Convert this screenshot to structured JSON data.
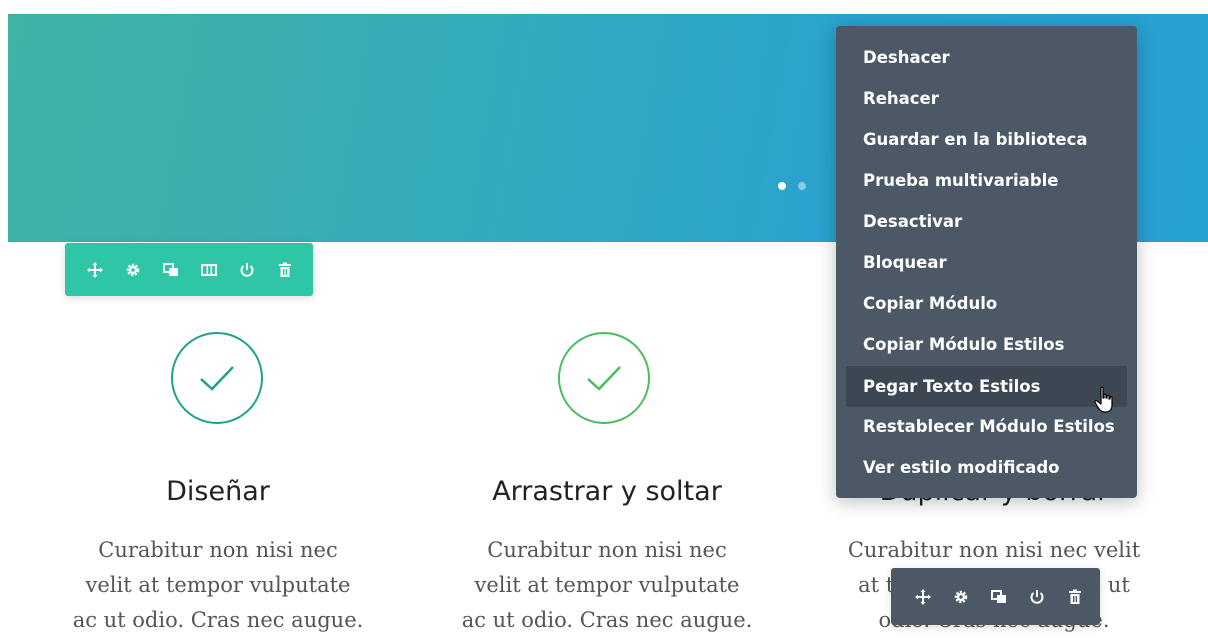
{
  "hero": {
    "slider_dots": [
      "active",
      "inactive"
    ]
  },
  "row_toolbar": {
    "icons": [
      "move-icon",
      "gear-icon",
      "clone-icon",
      "columns-icon",
      "power-icon",
      "trash-icon"
    ],
    "color": "#2ec6a6"
  },
  "columns": [
    {
      "heading": "Diseñar",
      "lines": [
        "Curabitur non nisi nec",
        "velit at tempor vulputate",
        "ac ut odio. Cras nec augue."
      ],
      "check_color": "#1fa18a"
    },
    {
      "heading": "Arrastrar y soltar",
      "lines": [
        "Curabitur non nisi nec",
        "velit at tempor vulputate",
        "ac ut odio. Cras nec augue."
      ],
      "check_color": "#4dbb5f"
    },
    {
      "heading": "Duplicar y borrar",
      "lines": [
        "Curabitur non nisi nec velit",
        "at tempor vulputate ac ut",
        "odio. Cras nec augue."
      ]
    }
  ],
  "context_menu": {
    "items": [
      "Deshacer",
      "Rehacer",
      "Guardar en la biblioteca",
      "Prueba multivariable",
      "Desactivar",
      "Bloquear",
      "Copiar Módulo",
      "Copiar Módulo Estilos",
      "Pegar Texto Estilos",
      "Restablecer Módulo Estilos",
      "Ver estilo modificado"
    ],
    "hovered": "Pegar Texto Estilos",
    "background": "#4c5866"
  },
  "module_toolbar": {
    "icons": [
      "move-icon",
      "gear-icon",
      "clone-icon",
      "power-icon",
      "trash-icon"
    ],
    "color": "#4c5866"
  }
}
